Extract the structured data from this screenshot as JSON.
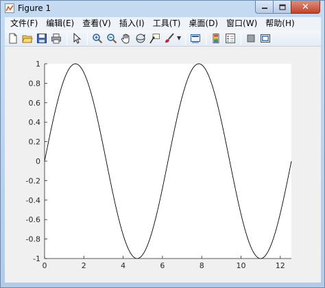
{
  "window": {
    "title": "Figure 1",
    "close_glyph": "✕"
  },
  "menu": {
    "items": [
      "文件(F)",
      "编辑(E)",
      "查看(V)",
      "插入(I)",
      "工具(T)",
      "桌面(D)",
      "窗口(W)",
      "帮助(H)"
    ]
  },
  "toolbar": {
    "icons": [
      "new-figure-icon",
      "open-file-icon",
      "save-icon",
      "print-icon",
      "pointer-icon",
      "zoom-in-icon",
      "zoom-out-icon",
      "pan-hand-icon",
      "rotate-3d-icon",
      "data-cursor-icon",
      "brush-icon",
      "dropdown-arrow-icon",
      "link-plot-icon",
      "colorbar-icon",
      "legend-icon",
      "hide-plot-tools-icon",
      "show-plot-tools-icon"
    ]
  },
  "chart_data": {
    "type": "line",
    "title": "",
    "xlabel": "",
    "ylabel": "",
    "xlim": [
      0,
      12.566
    ],
    "ylim": [
      -1,
      1
    ],
    "grid": false,
    "x_ticks": [
      "0",
      "2",
      "4",
      "6",
      "8",
      "10",
      "12"
    ],
    "y_ticks": [
      "1",
      "0.8",
      "0.6",
      "0.4",
      "0.2",
      "0",
      "-0.2",
      "-0.4",
      "-0.6",
      "-0.8",
      "-1"
    ],
    "x_tick_values": [
      0,
      2,
      4,
      6,
      8,
      10,
      12
    ],
    "y_tick_values": [
      1,
      0.8,
      0.6,
      0.4,
      0.2,
      0,
      -0.2,
      -0.4,
      -0.6,
      -0.8,
      -1
    ],
    "series": [
      {
        "color": "#000000",
        "x": [
          0,
          0.785,
          1.571,
          2.356,
          3.142,
          3.927,
          4.712,
          5.498,
          6.283,
          7.069,
          7.854,
          8.639,
          9.425,
          10.21,
          10.996,
          11.781,
          12.566
        ],
        "y": [
          0,
          0.707,
          1,
          0.707,
          0,
          -0.707,
          -1,
          -0.707,
          0,
          0.707,
          1,
          0.707,
          0,
          -0.707,
          -1,
          -0.707,
          0
        ]
      }
    ]
  }
}
